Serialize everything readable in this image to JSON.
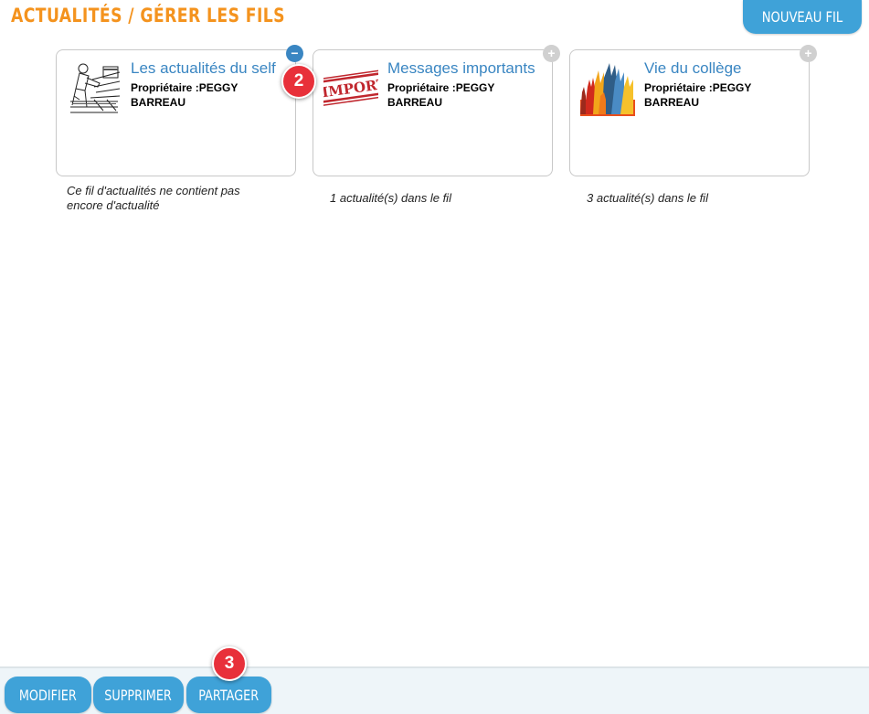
{
  "header": {
    "title": "ACTUALITÉS / GÉRER LES FILS",
    "new_button": "NOUVEAU FIL"
  },
  "cards": [
    {
      "title": "Les actualités du self",
      "owner": "Propriétaire :PEGGY BARREAU",
      "toggle": "−",
      "toggle_state": "selected",
      "status": "Ce fil d'actualités ne contient pas encore d'actualité",
      "thumbnail": "engraving-illustration"
    },
    {
      "title": "Messages importants",
      "owner": "Propriétaire :PEGGY BARREAU",
      "toggle": "+",
      "toggle_state": "unselected",
      "status": "1 actualité(s) dans le fil",
      "thumbnail": "important-stamp",
      "thumbnail_text": "IMPORTANT"
    },
    {
      "title": "Vie du collège",
      "owner": "Propriétaire :PEGGY BARREAU",
      "toggle": "+",
      "toggle_state": "unselected",
      "status": "3 actualité(s) dans le fil",
      "thumbnail": "raised-hands"
    }
  ],
  "badges": {
    "step2": "2",
    "step3": "3"
  },
  "toolbar": {
    "modify": "MODIFIER",
    "delete": "SUPPRIMER",
    "share": "PARTAGER"
  },
  "colors": {
    "title_orange": "#f4931e",
    "button_blue": "#3fa2d8",
    "link_blue": "#3a86c2",
    "badge_red": "#e8303a"
  }
}
